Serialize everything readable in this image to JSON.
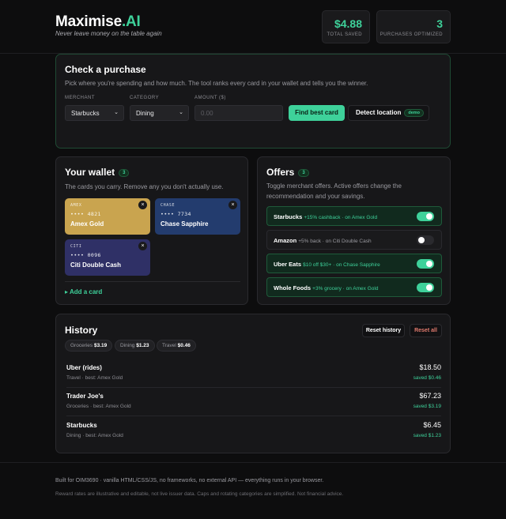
{
  "header": {
    "brand_main": "Maximise",
    "brand_accent": ".AI",
    "tagline": "Never leave money on the table again",
    "total_saved": "$4.88",
    "total_saved_label": "TOTAL SAVED",
    "purchases_optimized": "3",
    "purchases_optimized_label": "PURCHASES OPTIMIZED"
  },
  "check": {
    "title": "Check a purchase",
    "description": "Pick where you're spending and how much. The tool ranks every card in your wallet and tells you the winner.",
    "merchant_label": "MERCHANT",
    "merchant_value": "Starbucks",
    "category_label": "CATEGORY",
    "category_value": "Dining",
    "amount_label": "AMOUNT ($)",
    "amount_placeholder": "0.00",
    "find_button": "Find best card",
    "detect_button": "Detect location",
    "demo_tag": "demo"
  },
  "wallet": {
    "title": "Your wallet",
    "count": "3",
    "description": "The cards you carry. Remove any you don't actually use.",
    "remove_glyph": "×",
    "cards": [
      {
        "issuer": "AMEX",
        "number": "•••• 4821",
        "name": "Amex Gold",
        "color": "#c9a44f"
      },
      {
        "issuer": "CHASE",
        "number": "•••• 7734",
        "name": "Chase Sapphire",
        "color": "#233c6e"
      },
      {
        "issuer": "CITI",
        "number": "•••• 0096",
        "name": "Citi Double Cash",
        "color": "#2f3066"
      }
    ],
    "add_card": "▸ Add a card"
  },
  "offers": {
    "title": "Offers",
    "count": "3",
    "description": "Toggle merchant offers. Active offers change the recommendation and your savings.",
    "items": [
      {
        "merchant": "Starbucks",
        "rate": "+15% cashback",
        "on": " · on Amex Gold",
        "active": true
      },
      {
        "merchant": "Amazon",
        "rate": "+5% back",
        "on": " · on Citi Double Cash",
        "active": false
      },
      {
        "merchant": "Uber Eats",
        "rate": "$10 off $30+",
        "on": " · on Chase Sapphire",
        "active": true
      },
      {
        "merchant": "Whole Foods",
        "rate": "+3% grocery",
        "on": " · on Amex Gold",
        "active": true
      }
    ]
  },
  "history": {
    "title": "History",
    "reset_history": "Reset history",
    "reset_all": "Reset all",
    "chips": [
      {
        "label": "Groceries ",
        "value": "$3.19"
      },
      {
        "label": "Dining ",
        "value": "$1.23"
      },
      {
        "label": "Travel ",
        "value": "$0.46"
      }
    ],
    "rows": [
      {
        "name": "Uber (rides)",
        "sub": "Travel · best: Amex Gold",
        "amount": "$18.50",
        "saved": "saved $0.46"
      },
      {
        "name": "Trader Joe's",
        "sub": "Groceries · best: Amex Gold",
        "amount": "$67.23",
        "saved": "saved $3.19"
      },
      {
        "name": "Starbucks",
        "sub": "Dining · best: Amex Gold",
        "amount": "$6.45",
        "saved": "saved $1.23"
      }
    ]
  },
  "footer": {
    "line1": "Built for OIM3690 · vanilla HTML/CSS/JS, no frameworks, no external API — everything runs in your browser.",
    "line2": "Reward rates are illustrative and editable, not live issuer data. Caps and rotating categories are simplified. Not financial advice."
  },
  "colors": {
    "accent": "#3ed19a",
    "danger": "#e27b6e",
    "background": "#0d0d0e"
  }
}
